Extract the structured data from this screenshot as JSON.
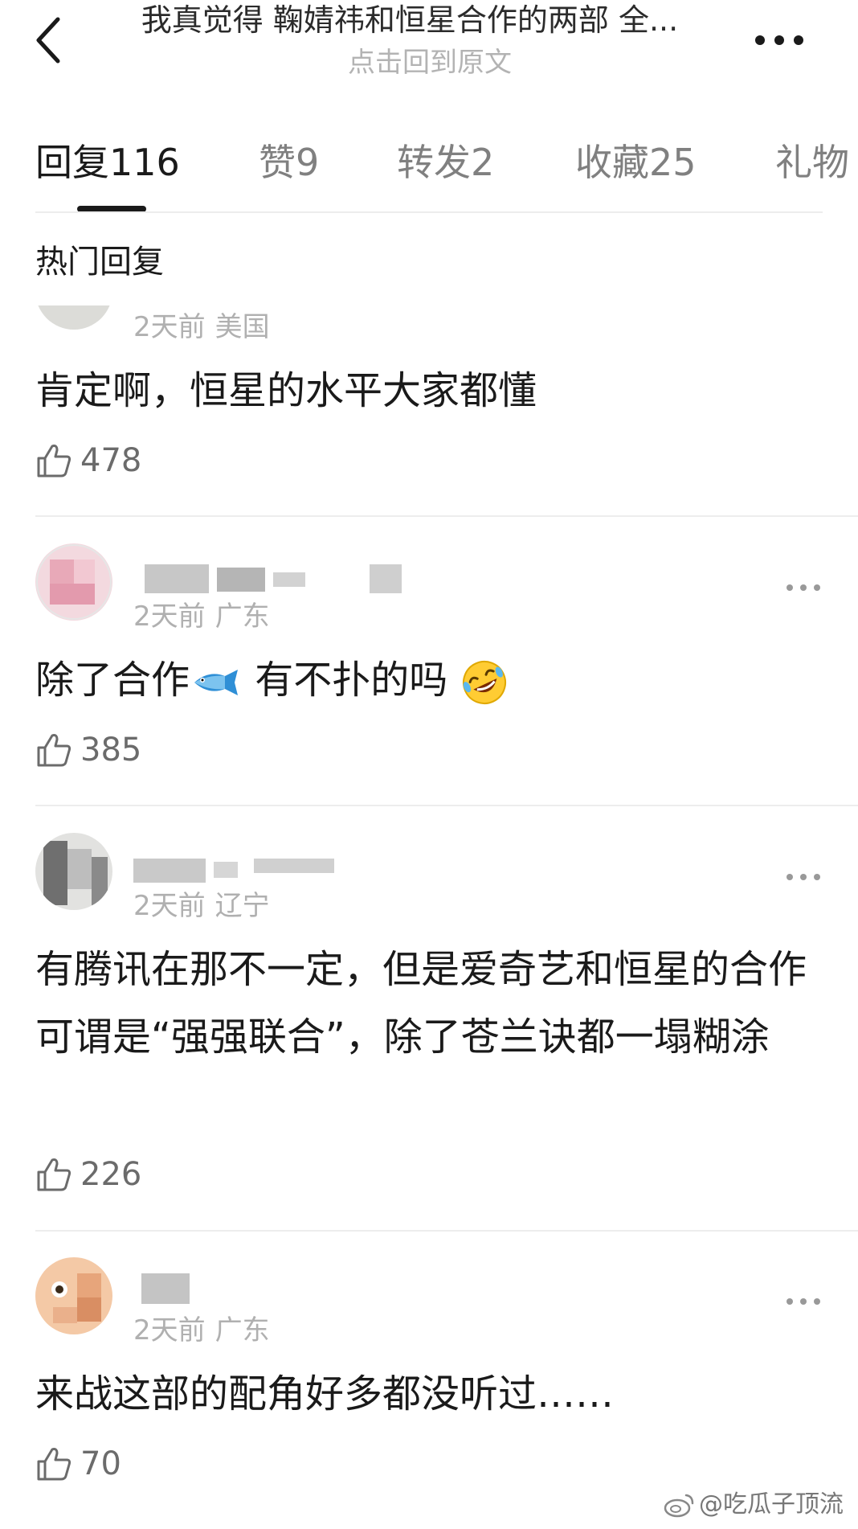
{
  "header": {
    "title": "我真觉得 鞠婧祎和恒星合作的两部  全...",
    "subtitle": "点击回到原文"
  },
  "tabs": [
    {
      "label": "回复",
      "count": "116"
    },
    {
      "label": "赞",
      "count": "9"
    },
    {
      "label": "转发",
      "count": "2"
    },
    {
      "label": "收藏",
      "count": "25"
    },
    {
      "label": "礼物",
      "count": ""
    }
  ],
  "section_title": "热门回复",
  "comments": [
    {
      "time": "2天前",
      "location": "美国",
      "text": "肯定啊，恒星的水平大家都懂",
      "likes": "478"
    },
    {
      "time": "2天前",
      "location": "广东",
      "text_parts": [
        "除了合作",
        "有不扑的吗"
      ],
      "likes": "385"
    },
    {
      "time": "2天前",
      "location": "辽宁",
      "text": "有腾讯在那不一定，但是爱奇艺和恒星的合作可谓是“强强联合”，除了苍兰诀都一塌糊涂",
      "likes": "226"
    },
    {
      "time": "2天前",
      "location": "广东",
      "text": "来战这部的配角好多都没听过……",
      "likes": "70"
    }
  ],
  "watermark": "@吃瓜子顶流",
  "icons": {
    "back": "chevron-left-icon",
    "more": "more-dots-icon",
    "like": "thumbs-up-icon",
    "fish": "fish-emoji",
    "laugh": "rofl-emoji",
    "weibo": "weibo-logo-icon"
  }
}
